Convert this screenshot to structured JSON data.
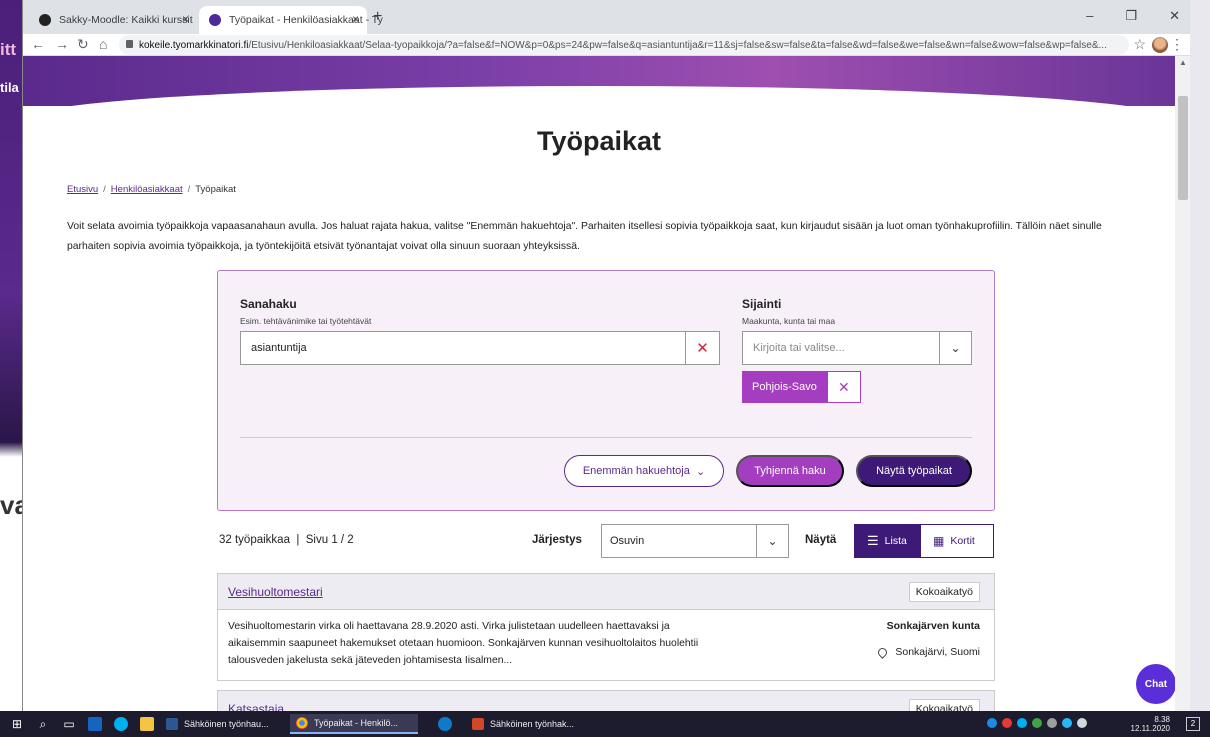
{
  "background_app": {
    "fragment1": "itt",
    "fragment2": "tila",
    "fragment3": "va"
  },
  "browser": {
    "tabs": [
      {
        "title": "Sakky-Moodle: Kaikki kurssit",
        "close": "×"
      },
      {
        "title": "Työpaikat - Henkilöasiakkaat - Ty",
        "close": "×"
      }
    ],
    "new_tab": "+",
    "window_buttons": {
      "minimize": "–",
      "maximize": "❐",
      "close": "✕"
    },
    "nav": {
      "back": "←",
      "forward": "→",
      "reload": "↻",
      "home": "⌂"
    },
    "url_host": "kokeile.tyomarkkinatori.fi",
    "url_path": "/Etusivu/Henkiloasiakkaat/Selaa-tyopaikkoja/?a=false&f=NOW&p=0&ps=24&pw=false&q=asiantuntija&r=11&sj=false&sw=false&ta=false&wd=false&we=false&wn=false&wow=false&wp=false&...",
    "star": "☆",
    "menu": "⋮"
  },
  "page": {
    "title": "Työpaikat",
    "breadcrumb": {
      "home": "Etusivu",
      "section": "Henkilöasiakkaat",
      "current": "Työpaikat",
      "separator": "/"
    },
    "intro": "Voit selata avoimia työpaikkoja vapaasanahaun avulla. Jos haluat rajata hakua, valitse \"Enemmän hakuehtoja\". Parhaiten itsellesi sopivia työpaikkoja saat, kun kirjaudut sisään ja luot oman työnhakuprofiilin. Tällöin näet sinulle parhaiten sopivia avoimia työpaikkoja, ja työntekijöitä etsivät työnantajat voivat olla sinuun suoraan yhteyksissä."
  },
  "search": {
    "keyword_label": "Sanahaku",
    "keyword_help": "Esim. tehtävänimike tai työtehtävät",
    "keyword_value": "asiantuntija",
    "clear_symbol": "✕",
    "location_label": "Sijainti",
    "location_help": "Maakunta, kunta tai maa",
    "location_placeholder": "Kirjoita tai valitse...",
    "dropdown_symbol": "⌄",
    "selected_location": "Pohjois-Savo",
    "chip_remove": "✕",
    "more_button": "Enemmän hakuehtoja",
    "more_chevron": "⌄",
    "clear_button": "Tyhjennä haku",
    "show_button": "Näytä työpaikat"
  },
  "results": {
    "count": "32 työpaikkaa",
    "page_info": "Sivu 1 / 2",
    "sort_label": "Järjestys",
    "sort_value": "Osuvin",
    "view_label": "Näytä",
    "view_list": "Lista",
    "view_cards": "Kortit",
    "items": [
      {
        "title": "Vesihuoltomestari",
        "type": "Kokoaikatyö",
        "description": "Vesihuoltomestarin virka oli haettavana 28.9.2020 asti. Virka julistetaan uudelleen haettavaksi ja aikaisemmin saapuneet hakemukset otetaan huomioon. Sonkajärven kunnan vesihuoltolaitos huolehtii talousveden jakelusta sekä jäteveden johtamisesta Iisalmen...",
        "employer": "Sonkajärven kunta",
        "location": "Sonkajärvi, Suomi"
      },
      {
        "title": "Katsastaja",
        "type": "Kokoaikatyö"
      }
    ]
  },
  "chat": {
    "label": "Chat"
  },
  "taskbar": {
    "items": [
      {
        "label": "Sähköinen työnhau..."
      },
      {
        "label": "Työpaikat - Henkilö..."
      },
      {
        "label": "Sähköinen työnhak..."
      }
    ],
    "time": "8.38",
    "date": "12.11.2020",
    "notifications": "2"
  },
  "colors": {
    "brand_purple": "#5a2a8c",
    "accent_magenta": "#a43dbf",
    "dark_button": "#3d1a78",
    "clear_red": "#d0263c"
  }
}
